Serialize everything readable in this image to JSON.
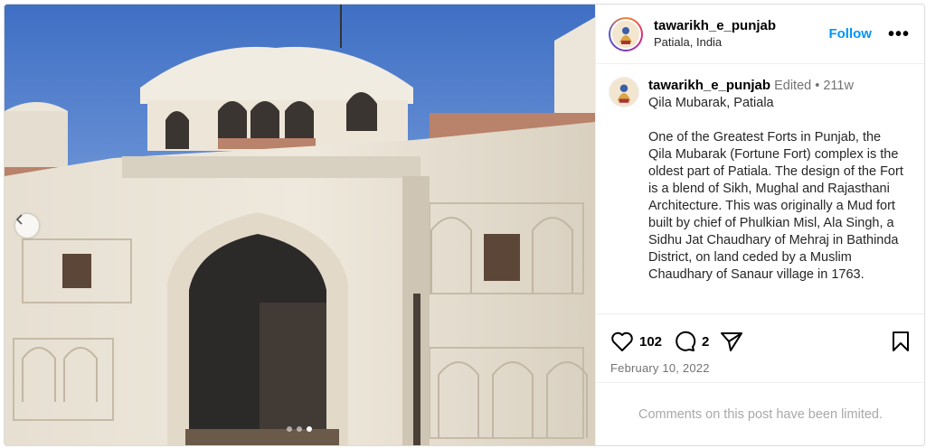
{
  "post": {
    "username": "tawarikh_e_punjab",
    "location": "Patiala, India",
    "follow_label": "Follow",
    "more_label": "•••",
    "image_alt": "Qila Mubarak fort gateway, Patiala",
    "carousel": {
      "total": 3,
      "active": 3
    }
  },
  "caption": {
    "username": "tawarikh_e_punjab",
    "edited_label": "Edited",
    "separator": "•",
    "age": "211w",
    "title": "Qila Mubarak, Patiala",
    "body": "One of the Greatest Forts in Punjab, the Qila Mubarak (Fortune Fort) complex is the oldest part of Patiala. The design of the Fort is a blend of Sikh, Mughal and Rajasthani Architecture. This was originally a Mud fort built by chief of Phulkian Misl, Ala Singh, a Sidhu Jat Chaudhary of Mehraj in Bathinda District, on land ceded by a Muslim Chaudhary of Sanaur village in 1763."
  },
  "actions": {
    "likes": "102",
    "comments": "2",
    "date": "February 10, 2022",
    "icons": [
      "heart-icon",
      "comment-icon",
      "share-icon",
      "bookmark-icon"
    ]
  },
  "comments": {
    "limited_text": "Comments on this post have been limited."
  },
  "colors": {
    "accent": "#0095f6",
    "muted": "#737373",
    "border": "#efefef"
  }
}
